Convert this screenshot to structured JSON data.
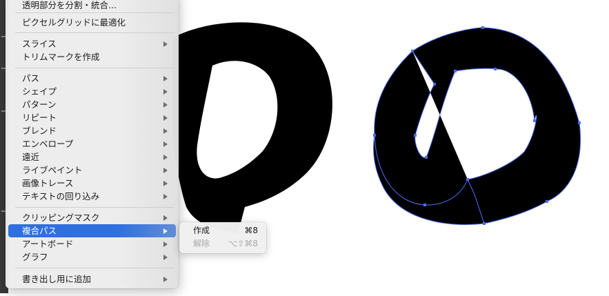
{
  "menu": {
    "items": [
      {
        "label": "透明部分を分割・統合...",
        "submenu": false
      },
      {
        "label": "ピクセルグリッドに最適化",
        "submenu": false
      },
      {
        "label": "スライス",
        "submenu": true
      },
      {
        "label": "トリムマークを作成",
        "submenu": false
      },
      {
        "label": "パス",
        "submenu": true
      },
      {
        "label": "シェイプ",
        "submenu": true
      },
      {
        "label": "パターン",
        "submenu": true
      },
      {
        "label": "リピート",
        "submenu": true
      },
      {
        "label": "ブレンド",
        "submenu": true
      },
      {
        "label": "エンベロープ",
        "submenu": true
      },
      {
        "label": "遠近",
        "submenu": true
      },
      {
        "label": "ライブペイント",
        "submenu": true
      },
      {
        "label": "画像トレース",
        "submenu": true
      },
      {
        "label": "テキストの回り込み",
        "submenu": true
      },
      {
        "label": "クリッピングマスク",
        "submenu": true
      },
      {
        "label": "複合パス",
        "submenu": true,
        "selected": true
      },
      {
        "label": "アートボード",
        "submenu": true
      },
      {
        "label": "グラフ",
        "submenu": true
      },
      {
        "label": "書き出し用に追加",
        "submenu": true
      }
    ]
  },
  "submenu": {
    "items": [
      {
        "label": "作成",
        "shortcut": "⌘8",
        "enabled": true
      },
      {
        "label": "解除",
        "shortcut": "⌥⇧⌘8",
        "enabled": false
      }
    ]
  },
  "canvas": {
    "glyph_left": "の",
    "glyph_right": "の",
    "selection_color": "#4a6cf0",
    "fill_color": "#000000"
  },
  "colors": {
    "menu_highlight": "#2f6fe0",
    "menu_background": "#ececec"
  }
}
